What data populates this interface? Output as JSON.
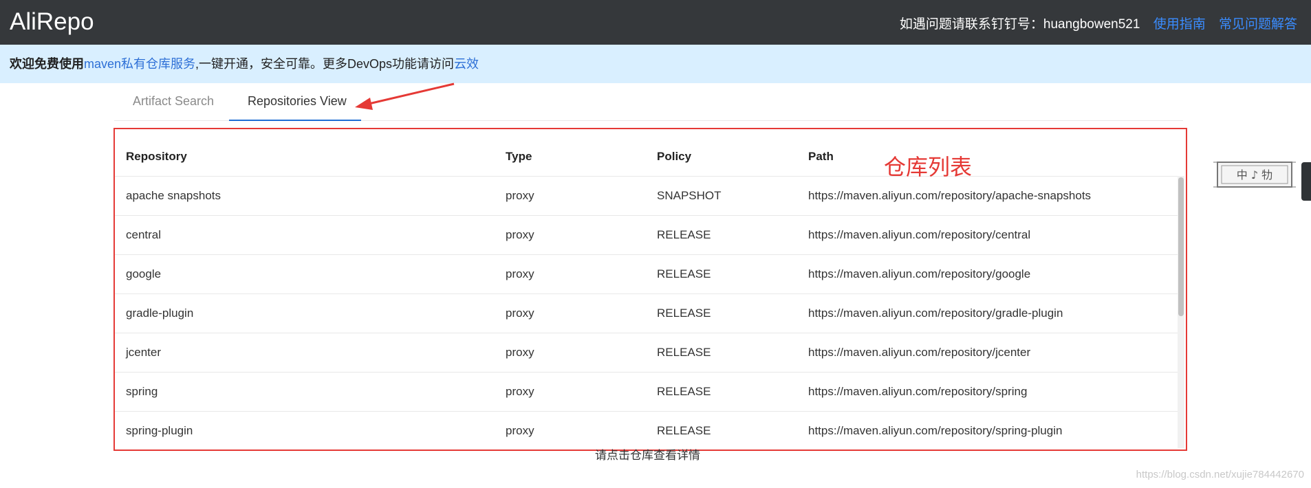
{
  "header": {
    "brand": "AliRepo",
    "contact": "如遇问题请联系钉钉号：huangbowen521",
    "guide_link": "使用指南",
    "faq_link": "常见问题解答"
  },
  "notice": {
    "prefix_bold": "欢迎免费使用",
    "link1": "maven私有仓库服务",
    "middle": ",一键开通，安全可靠。更多DevOps功能请访问",
    "link2": "云效"
  },
  "tabs": [
    {
      "label": "Artifact Search",
      "active": false
    },
    {
      "label": "Repositories View",
      "active": true
    }
  ],
  "table": {
    "headers": [
      "Repository",
      "Type",
      "Policy",
      "Path"
    ],
    "rows": [
      [
        "apache snapshots",
        "proxy",
        "SNAPSHOT",
        "https://maven.aliyun.com/repository/apache-snapshots"
      ],
      [
        "central",
        "proxy",
        "RELEASE",
        "https://maven.aliyun.com/repository/central"
      ],
      [
        "google",
        "proxy",
        "RELEASE",
        "https://maven.aliyun.com/repository/google"
      ],
      [
        "gradle-plugin",
        "proxy",
        "RELEASE",
        "https://maven.aliyun.com/repository/gradle-plugin"
      ],
      [
        "jcenter",
        "proxy",
        "RELEASE",
        "https://maven.aliyun.com/repository/jcenter"
      ],
      [
        "spring",
        "proxy",
        "RELEASE",
        "https://maven.aliyun.com/repository/spring"
      ],
      [
        "spring-plugin",
        "proxy",
        "RELEASE",
        "https://maven.aliyun.com/repository/spring-plugin"
      ]
    ]
  },
  "annotation": "仓库列表",
  "hint": "请点击仓库查看详情",
  "seal_text": "中 ♪ 牞",
  "watermark": "https://blog.csdn.net/xujie784442670",
  "colors": {
    "topbar": "#35383b",
    "notice_bg": "#d9efff",
    "link": "#3a8cff",
    "annotation_red": "#e53935",
    "tab_active": "#1f6ed4"
  }
}
